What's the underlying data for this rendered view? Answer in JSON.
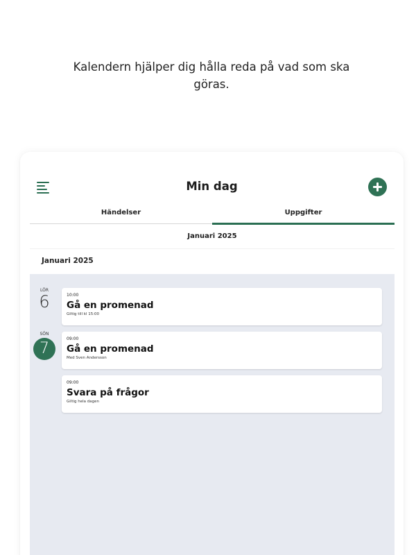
{
  "intro_text": "Kalendern hjälper dig hålla reda på vad som ska göras.",
  "header": {
    "title": "Min dag"
  },
  "tabs": [
    {
      "label": "Händelser",
      "active": false
    },
    {
      "label": "Uppgifter",
      "active": true
    }
  ],
  "month_selector": "Januari 2025",
  "section_label": "Januari 2025",
  "days": [
    {
      "weekday": "LÖR",
      "date": "6",
      "today": false,
      "events": [
        {
          "time": "10:00",
          "title": "Gå en promenad",
          "subtitle": "Giltig till kl 15:00"
        }
      ]
    },
    {
      "weekday": "SÖN",
      "date": "7",
      "today": true,
      "events": [
        {
          "time": "09:00",
          "title": "Gå en promenad",
          "subtitle": "Med Sven Andersson"
        },
        {
          "time": "09:00",
          "title": "Svara på frågor",
          "subtitle": "Giltig hela dagen"
        }
      ]
    }
  ],
  "colors": {
    "accent": "#2f7255",
    "list_background": "#e7eaf1"
  }
}
